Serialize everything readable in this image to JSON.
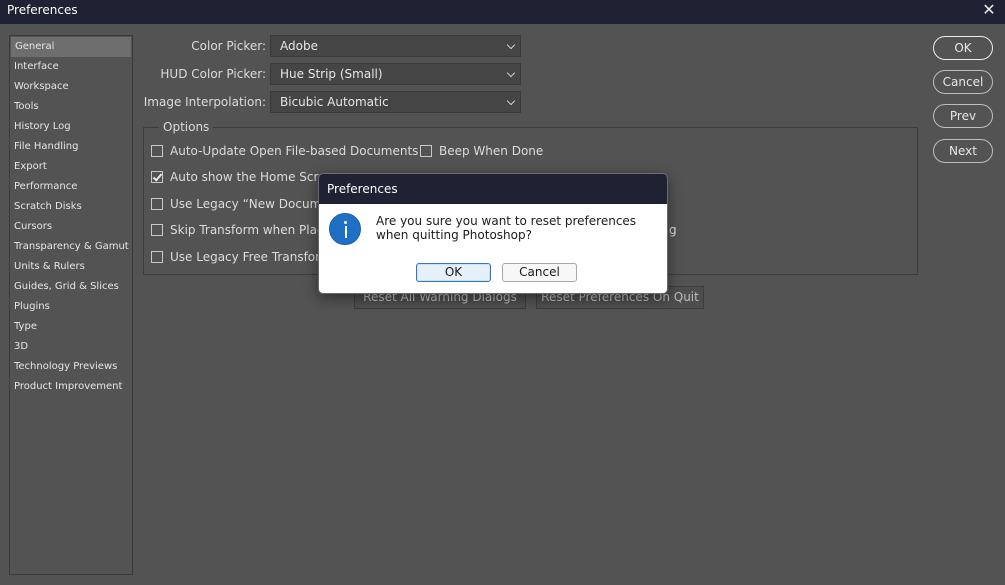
{
  "window": {
    "title": "Preferences",
    "close_glyph": "✕"
  },
  "sidebar": {
    "items": [
      {
        "label": "General",
        "selected": true
      },
      {
        "label": "Interface"
      },
      {
        "label": "Workspace"
      },
      {
        "label": "Tools"
      },
      {
        "label": "History Log"
      },
      {
        "label": "File Handling"
      },
      {
        "label": "Export"
      },
      {
        "label": "Performance"
      },
      {
        "label": "Scratch Disks"
      },
      {
        "label": "Cursors"
      },
      {
        "label": "Transparency & Gamut"
      },
      {
        "label": "Units & Rulers"
      },
      {
        "label": "Guides, Grid & Slices"
      },
      {
        "label": "Plugins"
      },
      {
        "label": "Type"
      },
      {
        "label": "3D"
      },
      {
        "label": "Technology Previews"
      },
      {
        "label": "Product Improvement"
      }
    ]
  },
  "fields": {
    "color_picker": {
      "label": "Color Picker:",
      "value": "Adobe"
    },
    "hud_color_picker": {
      "label": "HUD Color Picker:",
      "value": "Hue Strip (Small)"
    },
    "image_interpolation": {
      "label": "Image Interpolation:",
      "value": "Bicubic Automatic"
    }
  },
  "options": {
    "legend": "Options",
    "left_column": [
      {
        "label": "Auto-Update Open File-based Documents",
        "checked": false
      },
      {
        "label": "Auto show the Home Scree",
        "checked": true
      },
      {
        "label": "Use Legacy “New Docume",
        "checked": false
      },
      {
        "label": "Skip Transform when Placi",
        "checked": false
      },
      {
        "label": "Use Legacy Free Transform",
        "checked": false
      }
    ],
    "right_column": [
      {
        "label": "Beep When Done",
        "checked": false
      }
    ],
    "partial_text_right": "g"
  },
  "buttons": {
    "reset_warning": "Reset All Warning Dialogs",
    "reset_prefs": "Reset Preferences On Quit",
    "ok": "OK",
    "cancel": "Cancel",
    "prev": "Prev",
    "next": "Next"
  },
  "dialog": {
    "title": "Preferences",
    "icon": "info-icon",
    "message": "Are you sure you want to reset preferences when quitting Photoshop?",
    "ok_label": "OK",
    "cancel_label": "Cancel"
  }
}
